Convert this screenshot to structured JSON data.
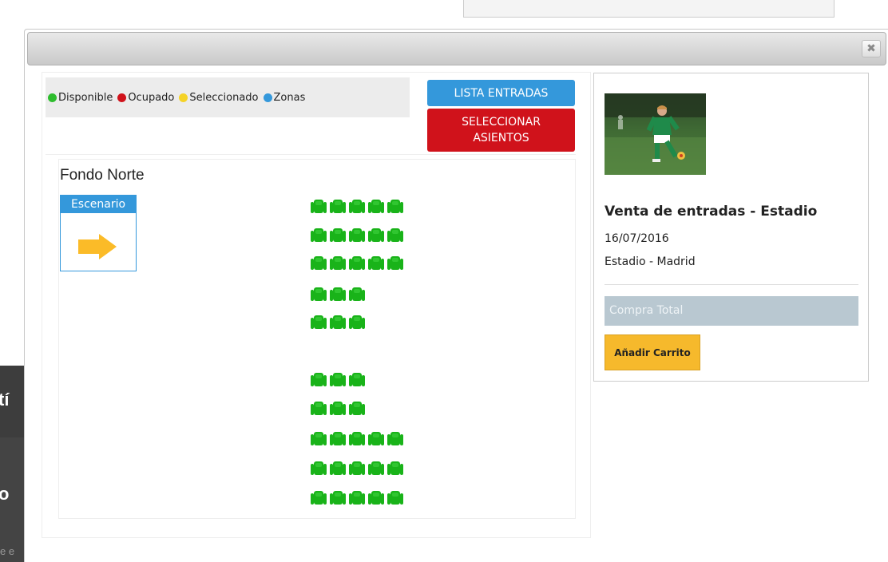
{
  "background": {
    "left_edge_text_1": "tí",
    "left_edge_text_2": "o",
    "left_edge_text_3": "e e"
  },
  "modal": {
    "close_glyph": "✖"
  },
  "legend": {
    "items": [
      {
        "label": "Disponible",
        "color": "#2ebd2e"
      },
      {
        "label": "Ocupado",
        "color": "#d0121b"
      },
      {
        "label": "Seleccionado",
        "color": "#f5d327"
      },
      {
        "label": "Zonas",
        "color": "#3498db"
      }
    ]
  },
  "buttons": {
    "lista_entradas": "LISTA ENTRADAS",
    "seleccionar_asientos": "SELECCIONAR ASIENTOS"
  },
  "seatmap": {
    "zone_title": "Fondo Norte",
    "stage_label": "Escenario",
    "stage_arrow_icon": "arrow-right-icon",
    "seat_color": "#19b319",
    "seat_state": "Disponible",
    "rows_seat_counts": [
      5,
      5,
      5,
      3,
      3,
      3,
      3,
      5,
      5,
      5
    ]
  },
  "event": {
    "image_icon": "soccer-player-photo",
    "title": "Venta de entradas - Estadio",
    "date": "16/07/2016",
    "venue": "Estadio - Madrid",
    "total_label": "Compra Total",
    "add_to_cart": "Añadir Carrito"
  }
}
